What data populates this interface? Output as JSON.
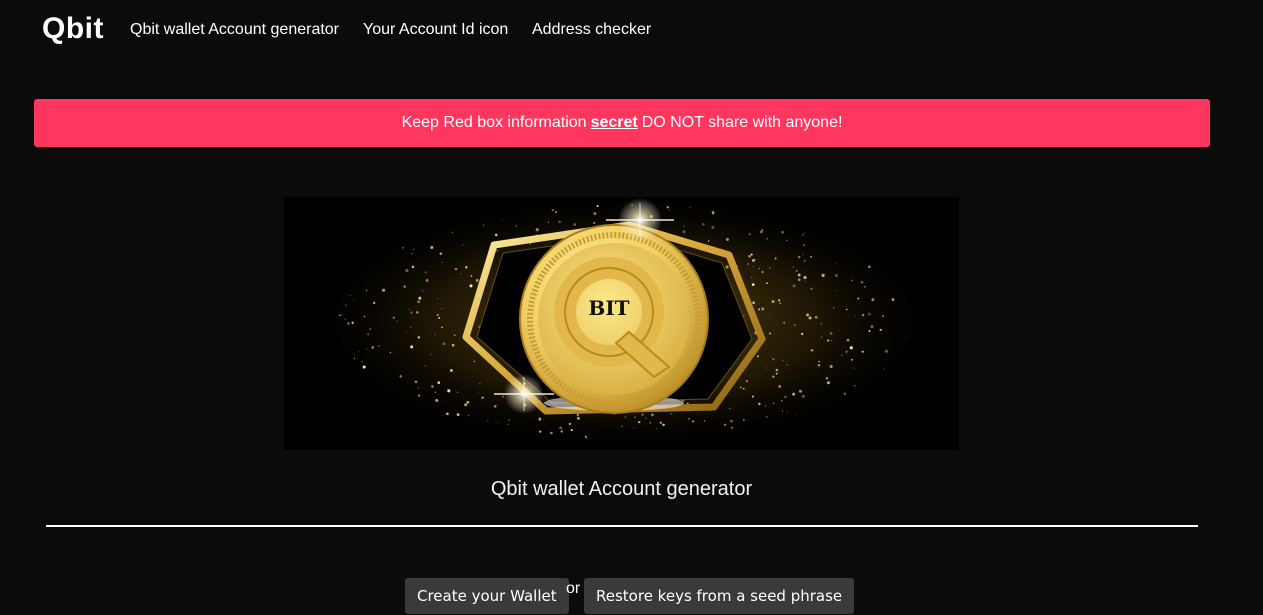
{
  "nav": {
    "brand": "Qbit",
    "links": [
      "Qbit wallet Account generator",
      "Your Account Id icon",
      "Address checker"
    ]
  },
  "alert": {
    "prefix": "Keep Red box information",
    "emphasis": "secret",
    "suffix": "DO NOT share with anyone!",
    "color": "#ff375f"
  },
  "banner": {
    "coin_text": "BIT",
    "coin_letter": "Q"
  },
  "main": {
    "title": "Qbit wallet Account generator",
    "create_button": "Create your Wallet",
    "or_text": "or",
    "restore_button": "Restore keys from a seed phrase"
  },
  "colors": {
    "background": "#0b0b0b",
    "gold": "#e8c655",
    "button": "#3a3a3a"
  }
}
